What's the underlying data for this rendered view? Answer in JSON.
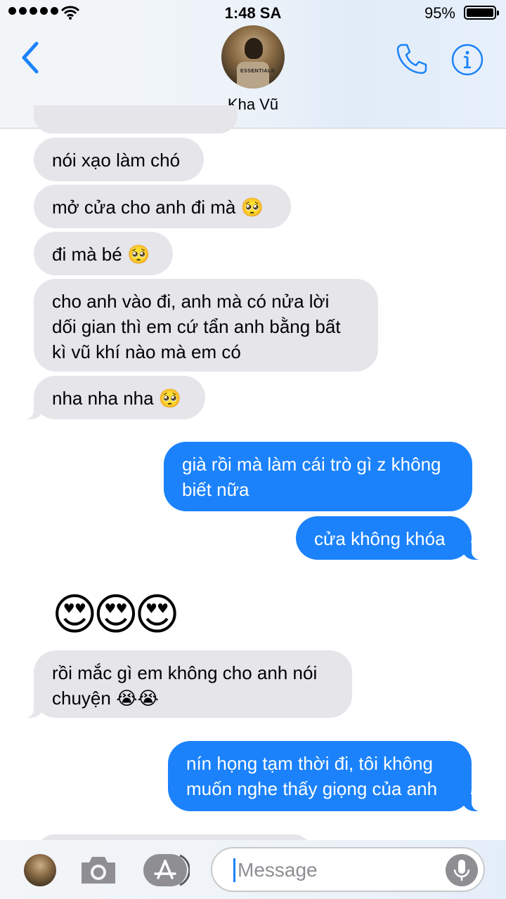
{
  "status_bar": {
    "time": "1:48 SA",
    "battery_percent": "95%",
    "battery_level": 0.95,
    "signal_bars": 5
  },
  "header": {
    "back_icon": "chevron-left-icon",
    "contact_name": "Kha Vũ",
    "avatar_text": "ESSENTIALS",
    "phone_icon": "phone-icon",
    "info_icon": "info-icon"
  },
  "messages": [
    {
      "direction": "in",
      "text": "nói xạo làm chó"
    },
    {
      "direction": "in",
      "text": "mở cửa cho anh đi mà 🥺"
    },
    {
      "direction": "in",
      "text": "đi mà bé 🥺"
    },
    {
      "direction": "in",
      "text": "cho anh vào đi, anh mà có nửa lời\ndối gian thì em cứ tẩn anh bằng bất\nkì vũ khí nào mà em có"
    },
    {
      "direction": "in",
      "text": "nha nha nha 🥺"
    },
    {
      "direction": "out",
      "text": "già rồi mà làm cái trò gì z không\nbiết nữa"
    },
    {
      "direction": "out",
      "text": "cửa không khóa"
    },
    {
      "direction": "in",
      "text": "😍😍😍"
    },
    {
      "direction": "in",
      "text": "rồi mắc gì em không cho anh nói\nchuyện 😭😭"
    },
    {
      "direction": "out",
      "text": "nín họng tạm thời đi, tôi không\nmuốn nghe thấy giọng của anh"
    }
  ],
  "composer": {
    "placeholder": "Message",
    "camera_icon": "camera-icon",
    "appstore_icon": "app-store-icon",
    "mic_icon": "microphone-icon"
  },
  "colors": {
    "accent": "#1b82fb",
    "incoming_bubble": "#e5e5ea",
    "outgoing_bubble": "#1b82fb"
  }
}
